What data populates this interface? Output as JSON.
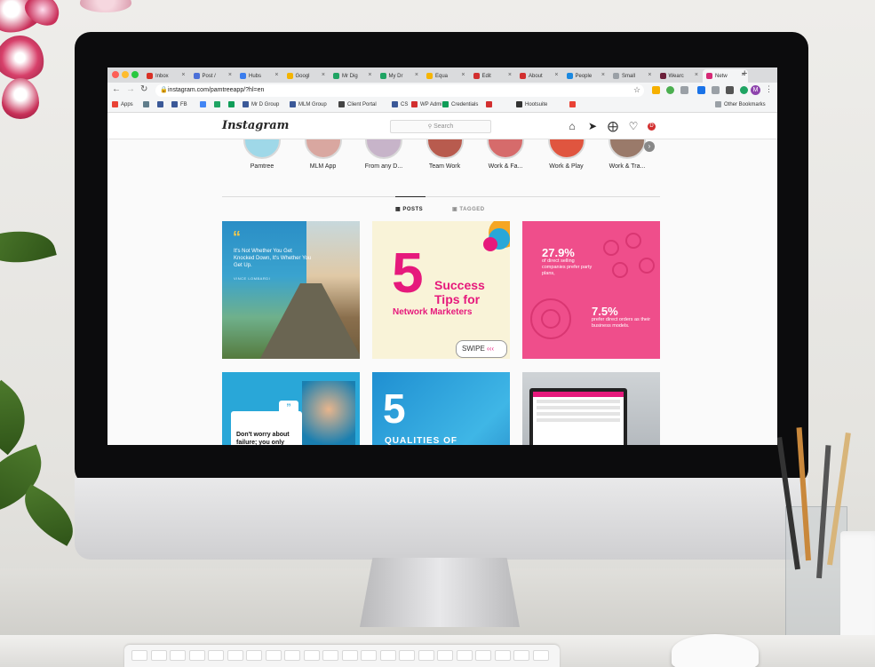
{
  "browser": {
    "tabs": [
      {
        "label": "Inbox",
        "icon": "gmail-icon",
        "color": "#d93025"
      },
      {
        "label": "Post /",
        "icon": "doc-icon",
        "color": "#4a6fd8"
      },
      {
        "label": "Hubs",
        "icon": "drive-icon",
        "color": "#3b7ded"
      },
      {
        "label": "Googl",
        "icon": "google-icon",
        "color": "#f4b400"
      },
      {
        "label": "Mr Dig",
        "icon": "drive-icon",
        "color": "#1fa463"
      },
      {
        "label": "My Dr",
        "icon": "drive-icon",
        "color": "#1fa463"
      },
      {
        "label": "Equa",
        "icon": "sheet-icon",
        "color": "#f7b500"
      },
      {
        "label": "Edit",
        "icon": "d-icon",
        "color": "#d22f2f"
      },
      {
        "label": "About",
        "icon": "d-icon",
        "color": "#d22f2f"
      },
      {
        "label": "People",
        "icon": "arrow-icon",
        "color": "#1a88e0"
      },
      {
        "label": "Small",
        "icon": "page-icon",
        "color": "#9aa0a6"
      },
      {
        "label": "Wearc",
        "icon": "brand-icon",
        "color": "#6b1f3a"
      },
      {
        "label": "Netw",
        "icon": "instagram-icon",
        "color": "#d62976"
      }
    ],
    "url": "instagram.com/pamtreeapp/?hl=en",
    "bookmarks": [
      {
        "label": "Apps",
        "color": "#e94235"
      },
      {
        "label": "",
        "color": "#607d8b"
      },
      {
        "label": "",
        "color": "#3b5998"
      },
      {
        "label": "FB",
        "color": "#3b5998"
      },
      {
        "label": "",
        "color": "#4285f4"
      },
      {
        "label": "",
        "color": "#1fa463"
      },
      {
        "label": "",
        "color": "#0f9d58"
      },
      {
        "label": "Mr D Group",
        "color": "#3b5998"
      },
      {
        "label": "MLM Group",
        "color": "#3b5998"
      },
      {
        "label": "Client Portal",
        "color": "#444444"
      },
      {
        "label": "CS",
        "color": "#3b5998"
      },
      {
        "label": "WP Admin",
        "color": "#d22f2f"
      },
      {
        "label": "Credentials",
        "color": "#0f9d58"
      },
      {
        "label": "",
        "color": "#d22f2f"
      },
      {
        "label": "Hootsuite",
        "color": "#333333"
      },
      {
        "label": "",
        "color": "#e94235"
      }
    ],
    "other_bookmarks": "Other Bookmarks"
  },
  "instagram": {
    "logo": "Instagram",
    "search_placeholder": "Search",
    "stories": [
      "Pamtree",
      "MLM App",
      "From any D...",
      "Team Work",
      "Work & Fa...",
      "Work & Play",
      "Work & Tra..."
    ],
    "tabs": {
      "posts": "POSTS",
      "tagged": "TAGGED"
    },
    "posts": [
      {
        "quote": "It's Not Whether You Get Knocked Down, It's Whether You Get Up.",
        "author": "VINCE LOMBARDI"
      },
      {
        "big_number": "5",
        "line1": "Success",
        "line2": "Tips for",
        "line3": "Network Marketers",
        "swipe": "SWIPE"
      },
      {
        "stat1_value": "27.9%",
        "stat1_text": "of direct selling companies prefer party plans,",
        "stat2_value": "7.5%",
        "stat2_text": "prefer direct orders as their business models."
      },
      {
        "text": "Don't worry about failure; you only have"
      },
      {
        "big_number": "5",
        "text": "QUALITIES OF"
      },
      {
        "type": "laptop-dashboard"
      }
    ]
  },
  "colors": {
    "pink": "#ef4e8b",
    "cyan": "#29a7d8",
    "cream": "#f9f3d8",
    "magenta": "#e6197c"
  }
}
